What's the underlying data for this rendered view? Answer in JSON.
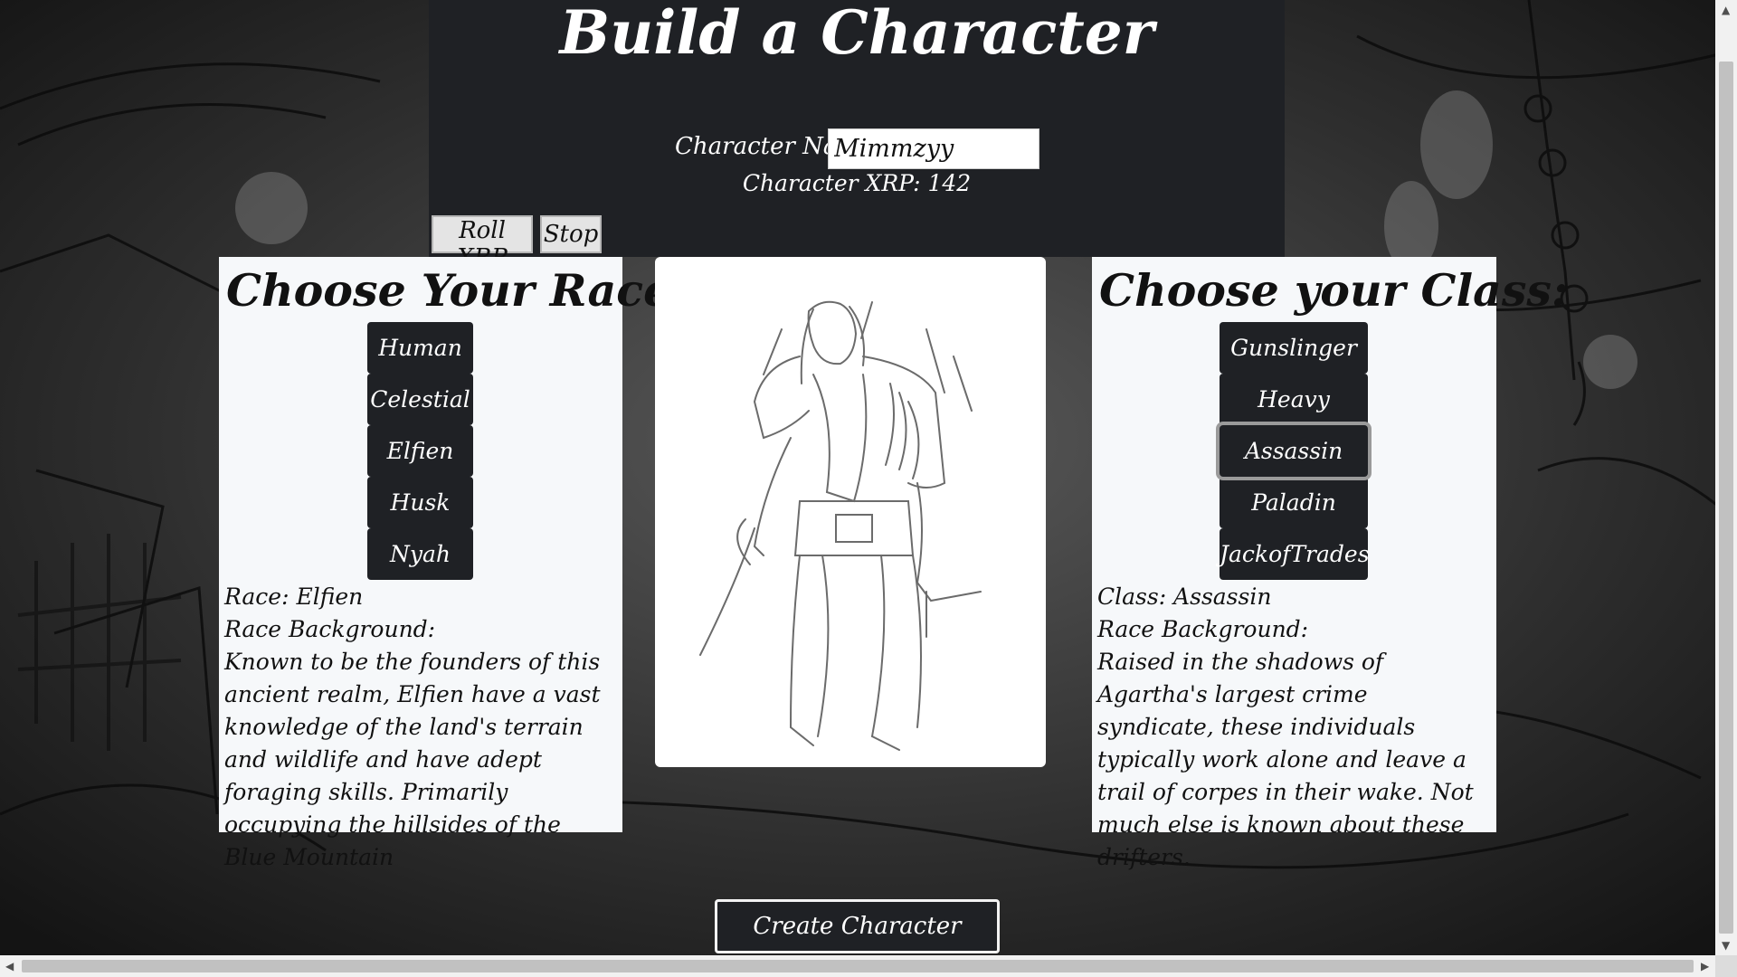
{
  "page": {
    "title": "Build a Character"
  },
  "character": {
    "name_label": "Character Name:",
    "name_value": "Mimmzyy",
    "xrp_line": "Character XRP: 142"
  },
  "controls": {
    "roll_label": "Roll XRP",
    "stop_label": "Stop"
  },
  "race_panel": {
    "heading": "Choose Your Race:",
    "options": [
      "Human",
      "Celestial",
      "Elfien",
      "Husk",
      "Nyah"
    ],
    "selected_line": "Race: Elfien",
    "background_label": "Race Background:",
    "background_text": "Known to be the founders of this ancient realm, Elfien have a vast knowledge of the land's terrain and wildlife and have adept foraging skills. Primarily occupying the hillsides of the Blue Mountain"
  },
  "class_panel": {
    "heading": "Choose your Class:",
    "options": [
      "Gunslinger",
      "Heavy",
      "Assassin",
      "Paladin",
      "JackofTrades"
    ],
    "selected_option": "Assassin",
    "selected_line": "Class: Assassin",
    "background_label": "Race Background:",
    "background_text": "Raised in the shadows of Agartha's largest crime syndicate, these individuals typically work alone and leave a trail of corpes in their wake. Not much else is known about these drifters."
  },
  "create_button": {
    "label": "Create Character"
  },
  "colors": {
    "dark": "#1f2125",
    "panel": "#f6f8fa",
    "accent_text": "#ffffff"
  }
}
